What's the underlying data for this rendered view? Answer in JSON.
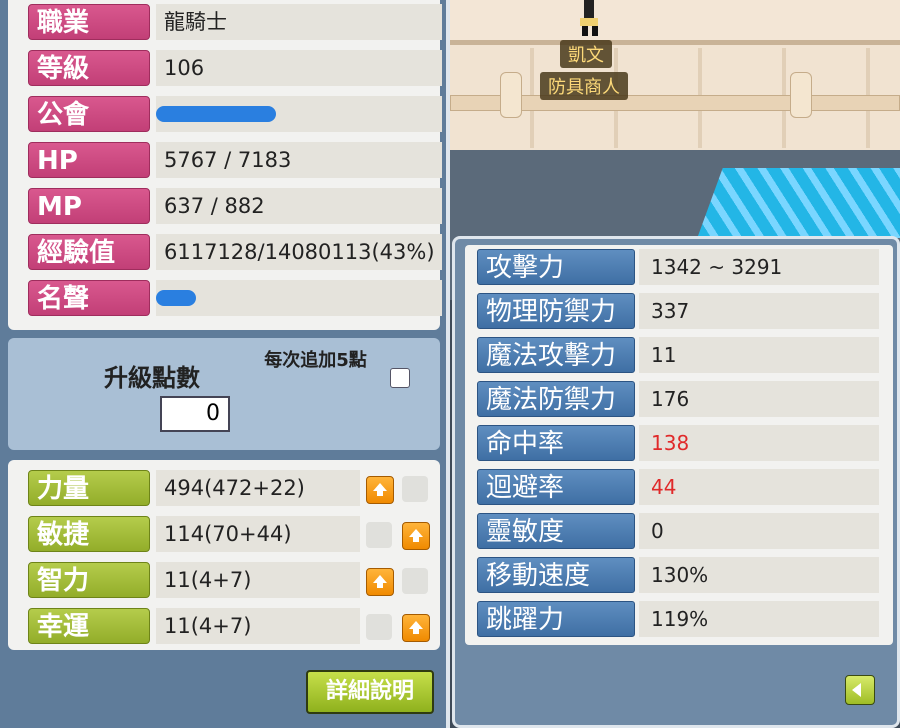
{
  "scene": {
    "npc_name": "凱文",
    "npc_title": "防具商人"
  },
  "info": {
    "rows": [
      {
        "label": "職業",
        "value": "龍騎士"
      },
      {
        "label": "等級",
        "value": "106"
      },
      {
        "label": "公會",
        "value": ""
      },
      {
        "label": "HP",
        "value": "5767 / 7183"
      },
      {
        "label": "MP",
        "value": "637 / 882"
      },
      {
        "label": "經驗值",
        "value": "6117128/14080113(43%)"
      },
      {
        "label": "名聲",
        "value": ""
      }
    ]
  },
  "level_points": {
    "label": "升級點數",
    "value": "0",
    "auto_label": "每次追加5點"
  },
  "stats": [
    {
      "label": "力量",
      "value": "494(472+22)",
      "up_button": "left"
    },
    {
      "label": "敏捷",
      "value": "114(70+44)",
      "up_button": "right"
    },
    {
      "label": "智力",
      "value": "11(4+7)",
      "up_button": "left"
    },
    {
      "label": "幸運",
      "value": "11(4+7)",
      "up_button": "right"
    }
  ],
  "detail_button": "詳細說明",
  "details": [
    {
      "label": "攻擊力",
      "value": "1342 ~ 3291",
      "color": "#222222"
    },
    {
      "label": "物理防禦力",
      "value": "337",
      "color": "#222222"
    },
    {
      "label": "魔法攻擊力",
      "value": "11",
      "color": "#222222"
    },
    {
      "label": "魔法防禦力",
      "value": "176",
      "color": "#222222"
    },
    {
      "label": "命中率",
      "value": "138",
      "color": "#e02a2a"
    },
    {
      "label": "迴避率",
      "value": "44",
      "color": "#e02a2a"
    },
    {
      "label": "靈敏度",
      "value": "0",
      "color": "#222222"
    },
    {
      "label": "移動速度",
      "value": "130%",
      "color": "#222222"
    },
    {
      "label": "跳躍力",
      "value": "119%",
      "color": "#222222"
    }
  ]
}
